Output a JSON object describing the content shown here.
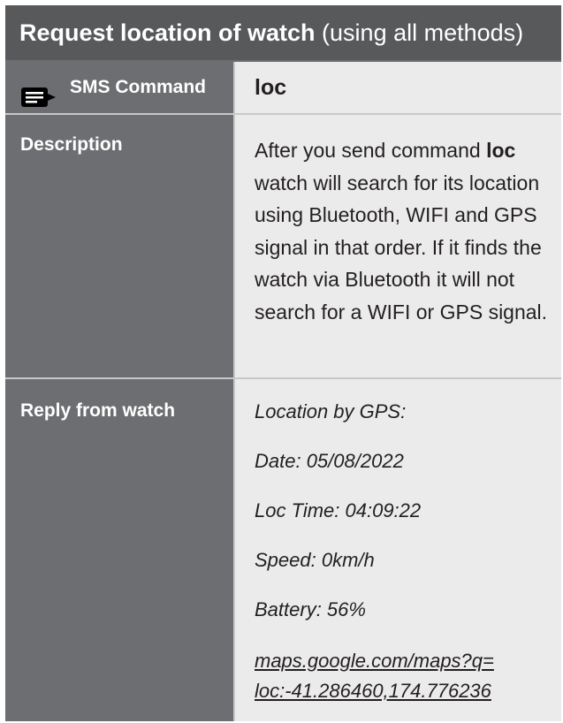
{
  "title": {
    "bold": "Request location of watch",
    "light": " (using all methods)"
  },
  "sms_row": {
    "label": "SMS Command",
    "value": "loc",
    "icon": "message-icon"
  },
  "description_row": {
    "label": "Description",
    "text_before": "After you send command ",
    "command": "loc",
    "text_after": " watch will search for its location using Bluetooth, WIFI and GPS signal in that order. If it finds the watch via Bluetooth it will not search for a WIFI or GPS signal."
  },
  "reply_row": {
    "label": "Reply from watch",
    "lines": [
      "Location by GPS:",
      "Date: 05/08/2022",
      "Loc Time: 04:09:22",
      "Speed: 0km/h",
      "Battery: 56%"
    ],
    "link_line1": "maps.google.com/maps?q=",
    "link_line2": "loc:-41.286460,174.776236"
  },
  "colors": {
    "title_bg": "#58595b",
    "label_bg": "#6d6e71",
    "value_bg": "#ebebec",
    "divider": "#c8c8ca"
  }
}
